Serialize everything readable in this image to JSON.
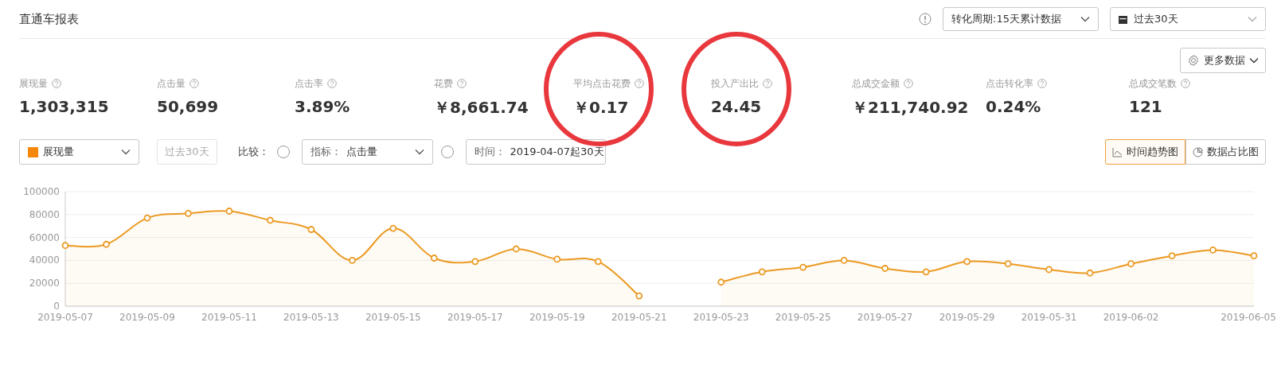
{
  "title": "直通车报表",
  "header_controls": {
    "conversion_period": "转化周期:15天累计数据",
    "date_range": "过去30天"
  },
  "more_data_button": "更多数据",
  "metrics": [
    {
      "label": "展现量",
      "value": "1,303,315",
      "circled": false
    },
    {
      "label": "点击量",
      "value": "50,699",
      "circled": false
    },
    {
      "label": "点击率",
      "value": "3.89%",
      "circled": false
    },
    {
      "label": "花费",
      "value": "￥8,661.74",
      "circled": false
    },
    {
      "label": "平均点击花费",
      "value": "￥0.17",
      "circled": true
    },
    {
      "label": "投入产出比",
      "value": "24.45",
      "circled": true
    },
    {
      "label": "总成交金额",
      "value": "￥211,740.92",
      "circled": false
    },
    {
      "label": "点击转化率",
      "value": "0.24%",
      "circled": false
    },
    {
      "label": "总成交笔数",
      "value": "121",
      "circled": false
    }
  ],
  "controls": {
    "metric_select": {
      "value": "展现量",
      "color": "#f5870a"
    },
    "range_box": "过去30天",
    "compare_label": "比较：",
    "compare_metric": {
      "selected": false,
      "prefix": "指标：",
      "value": "点击量"
    },
    "compare_time": {
      "selected": false,
      "prefix": "时间：",
      "value": "2019-04-07起30天"
    }
  },
  "view_tabs": [
    {
      "label": "时间趋势图",
      "kind": "line",
      "selected": true
    },
    {
      "label": "数据占比图",
      "kind": "pie",
      "selected": false
    }
  ],
  "chart_data": {
    "type": "area",
    "grid": true,
    "categories": [
      "2019-05-07",
      null,
      "2019-05-09",
      null,
      "2019-05-11",
      null,
      "2019-05-13",
      null,
      "2019-05-15",
      null,
      "2019-05-17",
      null,
      "2019-05-19",
      null,
      "2019-05-21",
      null,
      "2019-05-23",
      null,
      "2019-05-25",
      null,
      "2019-05-27",
      null,
      "2019-05-29",
      null,
      "2019-05-31",
      null,
      "2019-06-02",
      null,
      null,
      "2019-06-05"
    ],
    "series": [
      {
        "color": "#eb9a22",
        "values": [
          53000,
          54000,
          77000,
          81000,
          83000,
          75000,
          67000,
          40000,
          68000,
          42000,
          39000,
          50000,
          41000,
          39000,
          9000,
          null,
          21000,
          30000,
          34000,
          40000,
          33000,
          30000,
          39000,
          37000,
          32000,
          29000,
          37000,
          44000,
          49000,
          44000
        ]
      }
    ],
    "ylim": [
      0,
      100000
    ],
    "yticks": [
      0,
      20000,
      40000,
      60000,
      80000,
      100000
    ]
  }
}
